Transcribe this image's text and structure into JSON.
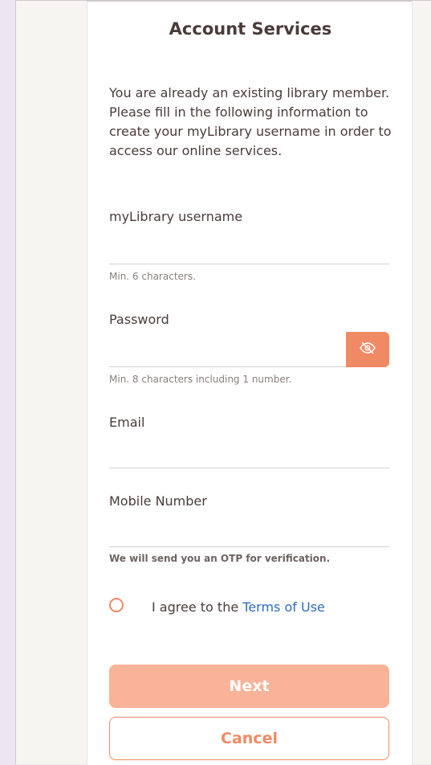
{
  "header": {
    "title": "Account Services"
  },
  "intro": {
    "line1": "You are already an existing library member.",
    "line2": "Please fill in the following information to create your myLibrary username in order to access our online services."
  },
  "fields": {
    "username": {
      "label": "myLibrary username",
      "value": "",
      "hint": "Min. 6 characters."
    },
    "password": {
      "label": "Password",
      "value": "",
      "hint": "Min. 8 characters including 1 number.",
      "toggle_icon": "eye-slash-icon"
    },
    "email": {
      "label": "Email",
      "value": ""
    },
    "mobile": {
      "label": "Mobile Number",
      "value": "",
      "hint": "We will send you an OTP for verification."
    }
  },
  "agreement": {
    "checked": false,
    "text": "I agree to the ",
    "link_text": "Terms of Use"
  },
  "actions": {
    "next_label": "Next",
    "cancel_label": "Cancel"
  },
  "colors": {
    "accent": "#f08a65",
    "accent_light": "#f9b399",
    "link": "#2f6bbf",
    "text": "#4a3b3b"
  }
}
